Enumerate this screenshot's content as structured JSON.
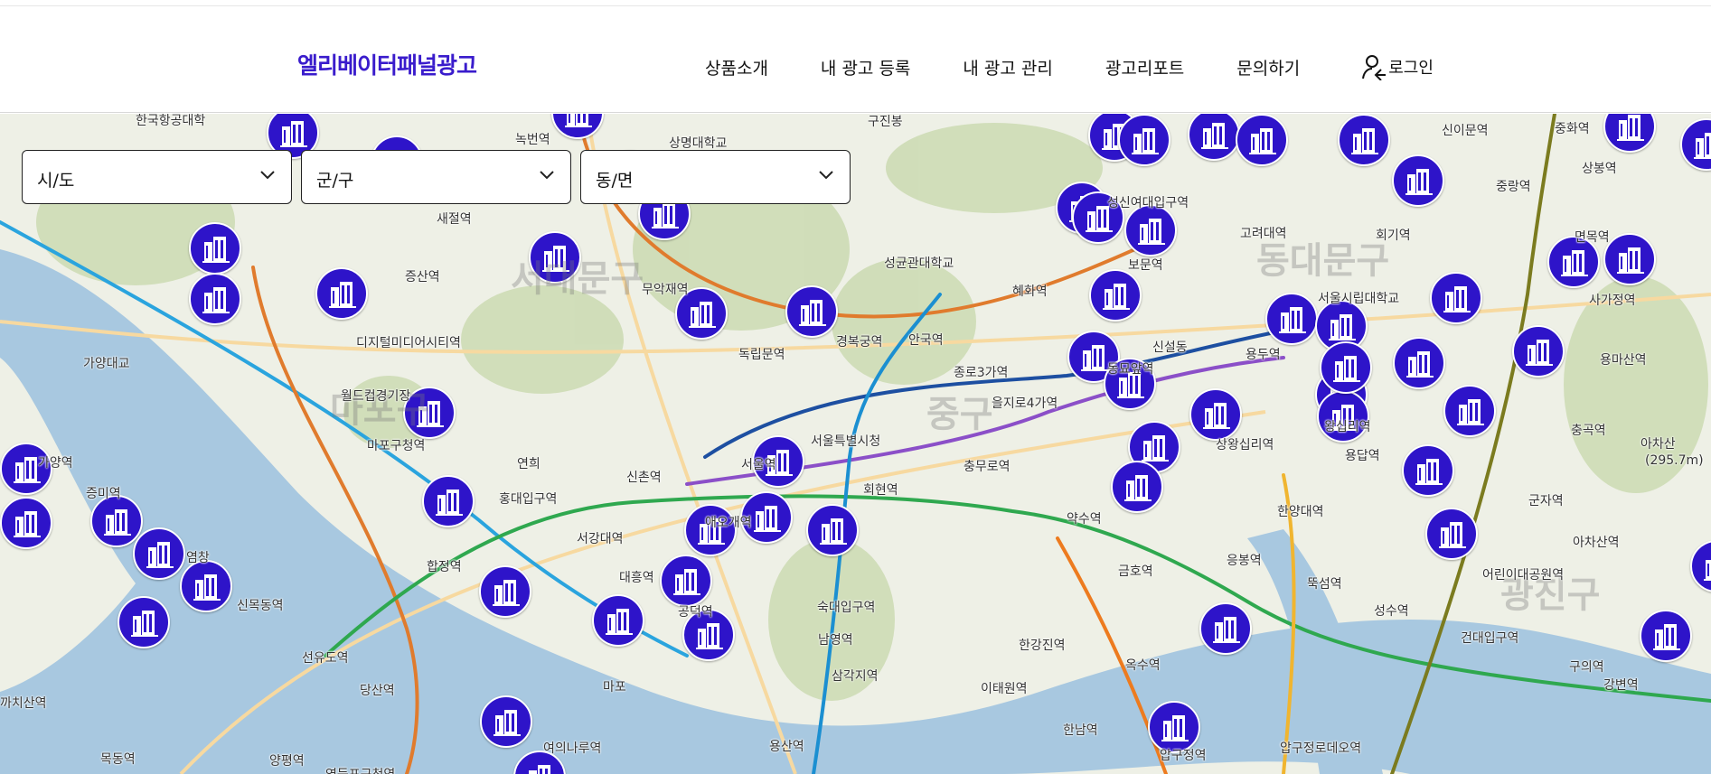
{
  "header": {
    "logo": "엘리베이터패널광고",
    "nav": [
      "상품소개",
      "내 광고 등록",
      "내 광고 관리",
      "광고리포트",
      "문의하기"
    ],
    "login_label": "로그인"
  },
  "filters": {
    "sido": "시/도",
    "gugun": "군/구",
    "dong": "동/면"
  },
  "map": {
    "colors": {
      "pin": "#2e14c9",
      "water": "#a8c8e0",
      "park": "#cddbb5"
    },
    "pin_icon": "building-icon",
    "district_labels": [
      "서대문구",
      "마포구",
      "중구",
      "광진구",
      "동대문구"
    ],
    "labels": [
      "한국항공대학",
      "녹번역",
      "상명대학교",
      "구진봉",
      "신이문역",
      "중화역",
      "상봉역",
      "중랑역",
      "새절역",
      "증산역",
      "무악재역",
      "성균관대학교",
      "혜화역",
      "성신여대입구역",
      "보문역",
      "고려대역",
      "회기역",
      "면목역",
      "사가정역",
      "용마산역",
      "서울시립대학교",
      "디지털미디어시티역",
      "가양대교",
      "월드컵경기장",
      "경복궁역",
      "안국역",
      "독립문역",
      "종로3가역",
      "신설동",
      "용두역",
      "동묘앞역",
      "마포구청역",
      "연희",
      "을지로4가역",
      "서울특별시청",
      "신촌역",
      "충무로역",
      "회현역",
      "상왕십리역",
      "왕십리역",
      "용답역",
      "군자역",
      "충곡역",
      "아차산",
      "(295.7m)",
      "아차산역",
      "가양역",
      "증미역",
      "홍대입구역",
      "서강대역",
      "애오개역",
      "약수역",
      "한양대역",
      "응봉역",
      "염창",
      "합정역",
      "대흥역",
      "공덕역",
      "숙대입구역",
      "금호역",
      "뚝섬역",
      "성수역",
      "어린이대공원역",
      "신목동역",
      "남영역",
      "삼각지역",
      "한강진역",
      "옥수역",
      "건대입구역",
      "구의역",
      "강변역",
      "선유도역",
      "당산역",
      "마포",
      "이태원역",
      "한남역",
      "압구정역",
      "압구정로데오역",
      "까치산역",
      "목동역",
      "양평역",
      "영등포구청역",
      "여의나루역",
      "용산역",
      "서울역"
    ]
  }
}
